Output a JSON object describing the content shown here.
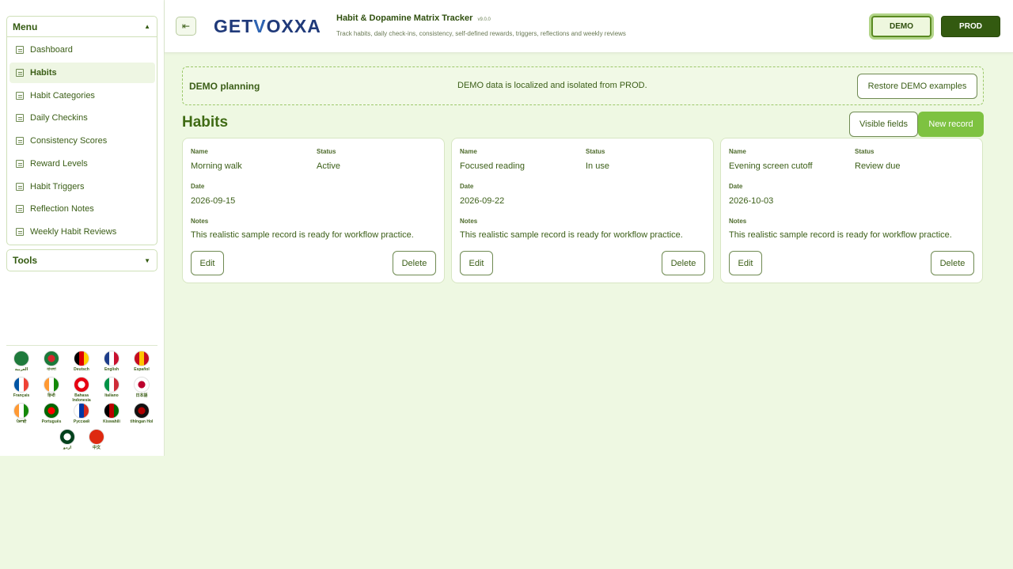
{
  "sidebar": {
    "menu_title": "Menu",
    "tools_title": "Tools",
    "items": [
      {
        "label": "Dashboard"
      },
      {
        "label": "Habits"
      },
      {
        "label": "Habit Categories"
      },
      {
        "label": "Daily Checkins"
      },
      {
        "label": "Consistency Scores"
      },
      {
        "label": "Reward Levels"
      },
      {
        "label": "Habit Triggers"
      },
      {
        "label": "Reflection Notes"
      },
      {
        "label": "Weekly Habit Reviews"
      }
    ],
    "active_item": "Habits",
    "languages": [
      {
        "label": "العربية",
        "colors": [
          "#1f7a3c",
          "#1f7a3c"
        ]
      },
      {
        "label": "বাংলা",
        "colors": [
          "#1a7a3a",
          "#d7262e"
        ]
      },
      {
        "label": "Deutsch",
        "colors": [
          "#000000",
          "#dd0000",
          "#ffce00"
        ]
      },
      {
        "label": "English",
        "colors": [
          "#1d3d8a",
          "#ffffff",
          "#c8102e"
        ]
      },
      {
        "label": "Español",
        "colors": [
          "#c60b1e",
          "#ffc400",
          "#c60b1e"
        ]
      },
      {
        "label": "Français",
        "colors": [
          "#0055a4",
          "#ffffff",
          "#ef4135"
        ]
      },
      {
        "label": "हिन्दी",
        "colors": [
          "#ff9933",
          "#ffffff",
          "#138808"
        ]
      },
      {
        "label": "Bahasa Indonesia",
        "colors": [
          "#e70011",
          "#ffffff"
        ]
      },
      {
        "label": "Italiano",
        "colors": [
          "#009246",
          "#ffffff",
          "#ce2b37"
        ]
      },
      {
        "label": "日本語",
        "colors": [
          "#ffffff",
          "#bc002d"
        ]
      },
      {
        "label": "ਪੰਜਾਬੀ",
        "colors": [
          "#ff9933",
          "#ffffff",
          "#138808"
        ]
      },
      {
        "label": "Português",
        "colors": [
          "#006600",
          "#ff0000"
        ]
      },
      {
        "label": "Русский",
        "colors": [
          "#ffffff",
          "#0039a6",
          "#d52b1e"
        ]
      },
      {
        "label": "Kiswahili",
        "colors": [
          "#000000",
          "#bb0000",
          "#006600"
        ]
      },
      {
        "label": "tlhIngan Hol",
        "colors": [
          "#111111",
          "#b00000"
        ]
      },
      {
        "label": "اردو",
        "colors": [
          "#01411c",
          "#ffffff"
        ]
      },
      {
        "label": "中文",
        "colors": [
          "#de2910",
          "#de2910"
        ]
      }
    ]
  },
  "header": {
    "collapse_icon": "sidebar-collapse-icon",
    "logo_prefix": "GET",
    "logo_v": "V",
    "logo_suffix": "OXXA",
    "title": "Habit & Dopamine Matrix Tracker",
    "version": "v9.0.0",
    "subtitle": "Track habits, daily check-ins, consistency, self-defined rewards, triggers, reflections and weekly reviews",
    "demo_label": "DEMO",
    "prod_label": "PROD"
  },
  "banner": {
    "title": "DEMO planning",
    "message": "DEMO data is localized and isolated from PROD.",
    "restore_label": "Restore DEMO examples"
  },
  "main": {
    "title": "Habits",
    "visible_fields_label": "Visible fields",
    "new_record_label": "New record",
    "field_labels": {
      "name": "Name",
      "status": "Status",
      "date": "Date",
      "notes": "Notes"
    },
    "edit_label": "Edit",
    "delete_label": "Delete",
    "records": [
      {
        "name": "Morning walk",
        "status": "Active",
        "date": "2026-09-15",
        "notes": "This realistic sample record is ready for workflow practice."
      },
      {
        "name": "Focused reading",
        "status": "In use",
        "date": "2026-09-22",
        "notes": "This realistic sample record is ready for workflow practice."
      },
      {
        "name": "Evening screen cutoff",
        "status": "Review due",
        "date": "2026-10-03",
        "notes": "This realistic sample record is ready for workflow practice."
      }
    ]
  },
  "colors": {
    "accent": "#7ec241",
    "dark": "#335a10",
    "background": "#eef8e2"
  }
}
